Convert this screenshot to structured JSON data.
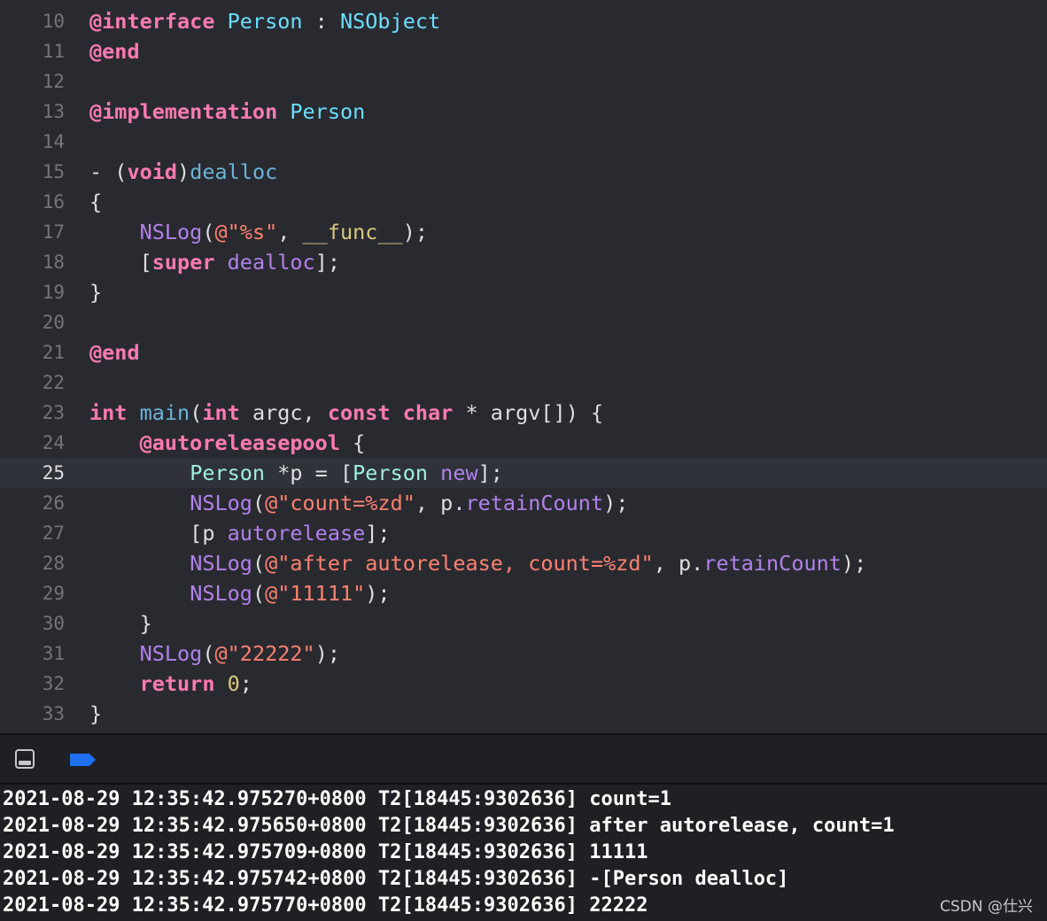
{
  "editor": {
    "lines": [
      {
        "num": "10",
        "tokens": [
          [
            "kw",
            "@interface"
          ],
          [
            "plain",
            " "
          ],
          [
            "type",
            "Person"
          ],
          [
            "plain",
            " : "
          ],
          [
            "type",
            "NSObject"
          ]
        ]
      },
      {
        "num": "11",
        "tokens": [
          [
            "kw",
            "@end"
          ]
        ]
      },
      {
        "num": "12",
        "tokens": []
      },
      {
        "num": "13",
        "tokens": [
          [
            "kw",
            "@implementation"
          ],
          [
            "plain",
            " "
          ],
          [
            "type",
            "Person"
          ]
        ]
      },
      {
        "num": "14",
        "tokens": []
      },
      {
        "num": "15",
        "tokens": [
          [
            "plain",
            "- ("
          ],
          [
            "kw",
            "void"
          ],
          [
            "plain",
            ")"
          ],
          [
            "meth",
            "dealloc"
          ]
        ]
      },
      {
        "num": "16",
        "tokens": [
          [
            "plain",
            "{"
          ]
        ]
      },
      {
        "num": "17",
        "tokens": [
          [
            "plain",
            "    "
          ],
          [
            "fn",
            "NSLog"
          ],
          [
            "plain",
            "("
          ],
          [
            "str",
            "@\"%s\""
          ],
          [
            "plain",
            ", "
          ],
          [
            "num",
            "__func__"
          ],
          [
            "plain",
            ");"
          ]
        ]
      },
      {
        "num": "18",
        "tokens": [
          [
            "plain",
            "    ["
          ],
          [
            "kw",
            "super"
          ],
          [
            "plain",
            " "
          ],
          [
            "fn",
            "dealloc"
          ],
          [
            "plain",
            "];"
          ]
        ]
      },
      {
        "num": "19",
        "tokens": [
          [
            "plain",
            "}"
          ]
        ]
      },
      {
        "num": "20",
        "tokens": []
      },
      {
        "num": "21",
        "tokens": [
          [
            "kw",
            "@end"
          ]
        ]
      },
      {
        "num": "22",
        "tokens": []
      },
      {
        "num": "23",
        "tokens": [
          [
            "kw",
            "int"
          ],
          [
            "plain",
            " "
          ],
          [
            "meth",
            "main"
          ],
          [
            "plain",
            "("
          ],
          [
            "kw",
            "int"
          ],
          [
            "plain",
            " argc, "
          ],
          [
            "kw",
            "const"
          ],
          [
            "plain",
            " "
          ],
          [
            "kw",
            "char"
          ],
          [
            "plain",
            " * argv[]) {"
          ]
        ]
      },
      {
        "num": "24",
        "tokens": [
          [
            "plain",
            "    "
          ],
          [
            "kw",
            "@autoreleasepool"
          ],
          [
            "plain",
            " {"
          ]
        ]
      },
      {
        "num": "25",
        "current": true,
        "tokens": [
          [
            "plain",
            "        "
          ],
          [
            "cls",
            "Person"
          ],
          [
            "plain",
            " *p = ["
          ],
          [
            "cls",
            "Person"
          ],
          [
            "plain",
            " "
          ],
          [
            "fn",
            "new"
          ],
          [
            "plain",
            "];"
          ]
        ]
      },
      {
        "num": "26",
        "tokens": [
          [
            "plain",
            "        "
          ],
          [
            "fn",
            "NSLog"
          ],
          [
            "plain",
            "("
          ],
          [
            "str",
            "@\"count=%zd\""
          ],
          [
            "plain",
            ", p."
          ],
          [
            "fn",
            "retainCount"
          ],
          [
            "plain",
            ");"
          ]
        ]
      },
      {
        "num": "27",
        "tokens": [
          [
            "plain",
            "        [p "
          ],
          [
            "fn",
            "autorelease"
          ],
          [
            "plain",
            "];"
          ]
        ]
      },
      {
        "num": "28",
        "tokens": [
          [
            "plain",
            "        "
          ],
          [
            "fn",
            "NSLog"
          ],
          [
            "plain",
            "("
          ],
          [
            "str",
            "@\"after autorelease, count=%zd\""
          ],
          [
            "plain",
            ", p."
          ],
          [
            "fn",
            "retainCount"
          ],
          [
            "plain",
            ");"
          ]
        ]
      },
      {
        "num": "29",
        "tokens": [
          [
            "plain",
            "        "
          ],
          [
            "fn",
            "NSLog"
          ],
          [
            "plain",
            "("
          ],
          [
            "str",
            "@\"11111\""
          ],
          [
            "plain",
            ");"
          ]
        ]
      },
      {
        "num": "30",
        "tokens": [
          [
            "plain",
            "    }"
          ]
        ]
      },
      {
        "num": "31",
        "tokens": [
          [
            "plain",
            "    "
          ],
          [
            "fn",
            "NSLog"
          ],
          [
            "plain",
            "("
          ],
          [
            "str",
            "@\"22222\""
          ],
          [
            "plain",
            ");"
          ]
        ]
      },
      {
        "num": "32",
        "tokens": [
          [
            "plain",
            "    "
          ],
          [
            "kw",
            "return"
          ],
          [
            "plain",
            " "
          ],
          [
            "num",
            "0"
          ],
          [
            "plain",
            ";"
          ]
        ]
      },
      {
        "num": "33",
        "tokens": [
          [
            "plain",
            "}"
          ]
        ]
      }
    ]
  },
  "console_bar": {
    "toggle_icon": "console-panel-icon",
    "breakpoint_icon": "breakpoint-icon",
    "breakpoint_color": "#1e6ff2"
  },
  "console": {
    "lines": [
      "2021-08-29 12:35:42.975270+0800 T2[18445:9302636] count=1",
      "2021-08-29 12:35:42.975650+0800 T2[18445:9302636] after autorelease, count=1",
      "2021-08-29 12:35:42.975709+0800 T2[18445:9302636] 11111",
      "2021-08-29 12:35:42.975742+0800 T2[18445:9302636] -[Person dealloc]",
      "2021-08-29 12:35:42.975770+0800 T2[18445:9302636] 22222"
    ]
  },
  "watermark": "CSDN @仕兴"
}
